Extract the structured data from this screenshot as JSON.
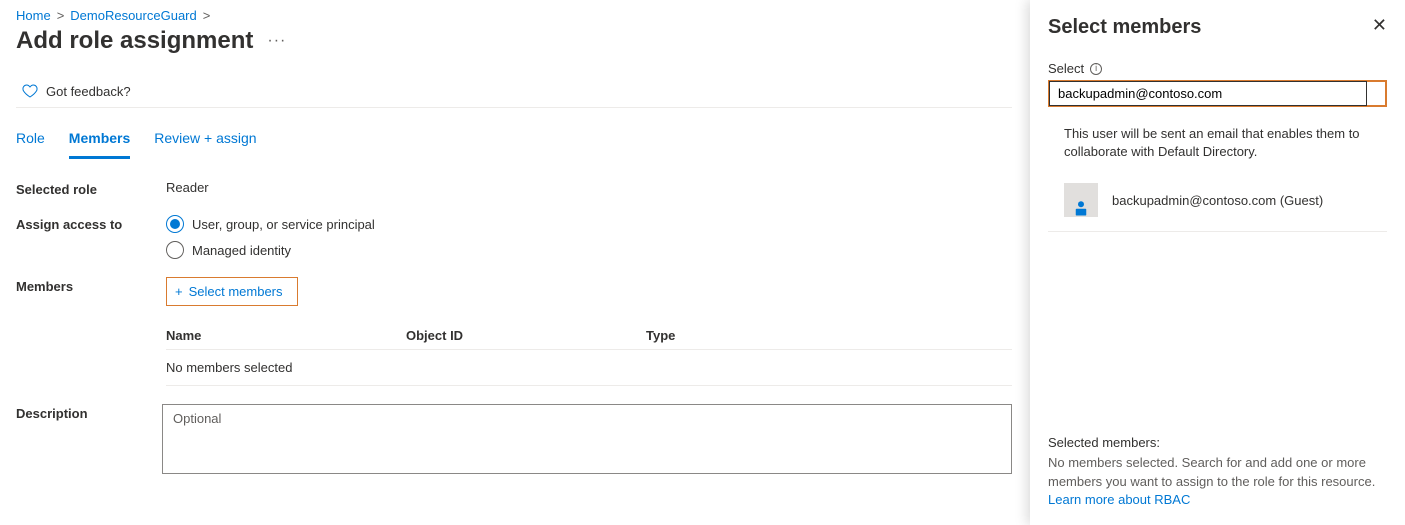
{
  "breadcrumb": {
    "home": "Home",
    "resource": "DemoResourceGuard"
  },
  "page": {
    "title": "Add role assignment",
    "feedback": "Got feedback?"
  },
  "tabs": {
    "role": "Role",
    "members": "Members",
    "review": "Review + assign"
  },
  "form": {
    "selected_role_label": "Selected role",
    "selected_role_value": "Reader",
    "assign_access_label": "Assign access to",
    "radio_user": "User, group, or service principal",
    "radio_managed": "Managed identity",
    "members_label": "Members",
    "select_members_btn": "Select members",
    "table": {
      "col_name": "Name",
      "col_objid": "Object ID",
      "col_type": "Type",
      "empty": "No members selected"
    },
    "description_label": "Description",
    "description_placeholder": "Optional"
  },
  "panel": {
    "title": "Select members",
    "select_label": "Select",
    "input_value": "backupadmin@contoso.com",
    "hint": "This user will be sent an email that enables them to collaborate with Default Directory.",
    "result_name": "backupadmin@contoso.com (Guest)",
    "footer_label": "Selected members:",
    "footer_text": "No members selected. Search for and add one or more members you want to assign to the role for this resource.",
    "footer_link": "Learn more about RBAC"
  }
}
